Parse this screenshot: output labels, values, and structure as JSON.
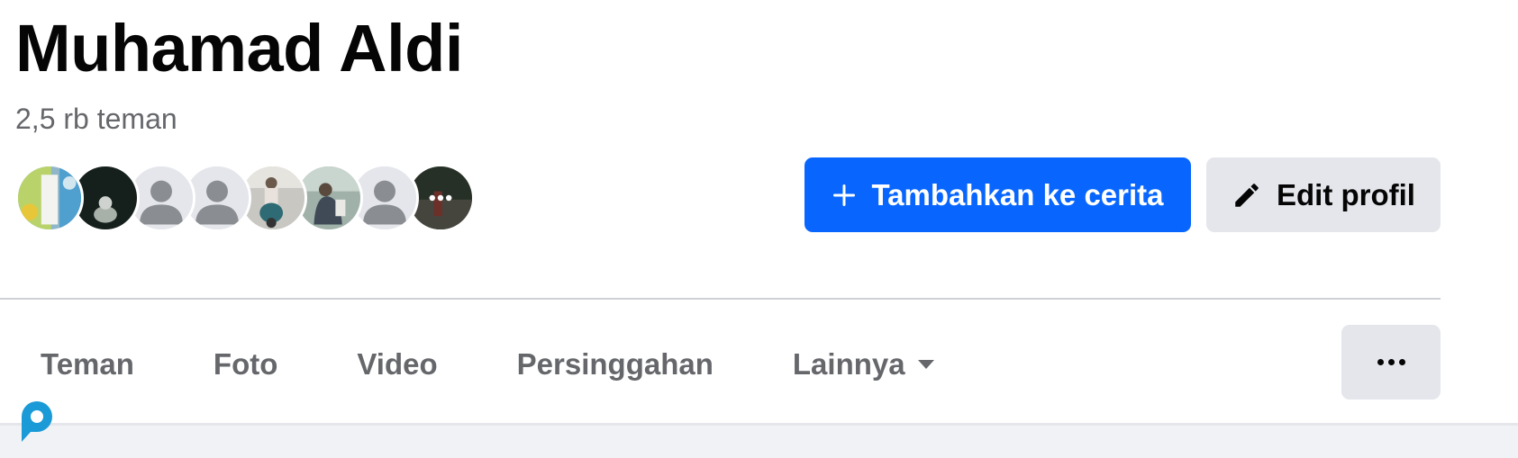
{
  "profile": {
    "name": "Muhamad Aldi",
    "friend_count": "2,5 rb teman"
  },
  "avatars": [
    {
      "kind": "photo-colorful"
    },
    {
      "kind": "photo-dark"
    },
    {
      "kind": "default"
    },
    {
      "kind": "default"
    },
    {
      "kind": "photo-motorbike"
    },
    {
      "kind": "photo-outdoor"
    },
    {
      "kind": "default"
    },
    {
      "kind": "photo-more"
    }
  ],
  "actions": {
    "add_story_label": "Tambahkan ke cerita",
    "add_story_icon": "plus-icon",
    "edit_profile_label": "Edit profil",
    "edit_profile_icon": "pencil-icon"
  },
  "tabs": [
    {
      "label": "Teman"
    },
    {
      "label": "Foto"
    },
    {
      "label": "Video"
    },
    {
      "label": "Persinggahan"
    },
    {
      "label": "Lainnya",
      "has_dropdown": true
    }
  ],
  "more_menu_icon": "more-horizontal-icon",
  "colors": {
    "primary": "#0866ff",
    "secondary_bg": "#e4e6eb",
    "text_primary": "#050505",
    "text_secondary": "#65676b"
  }
}
